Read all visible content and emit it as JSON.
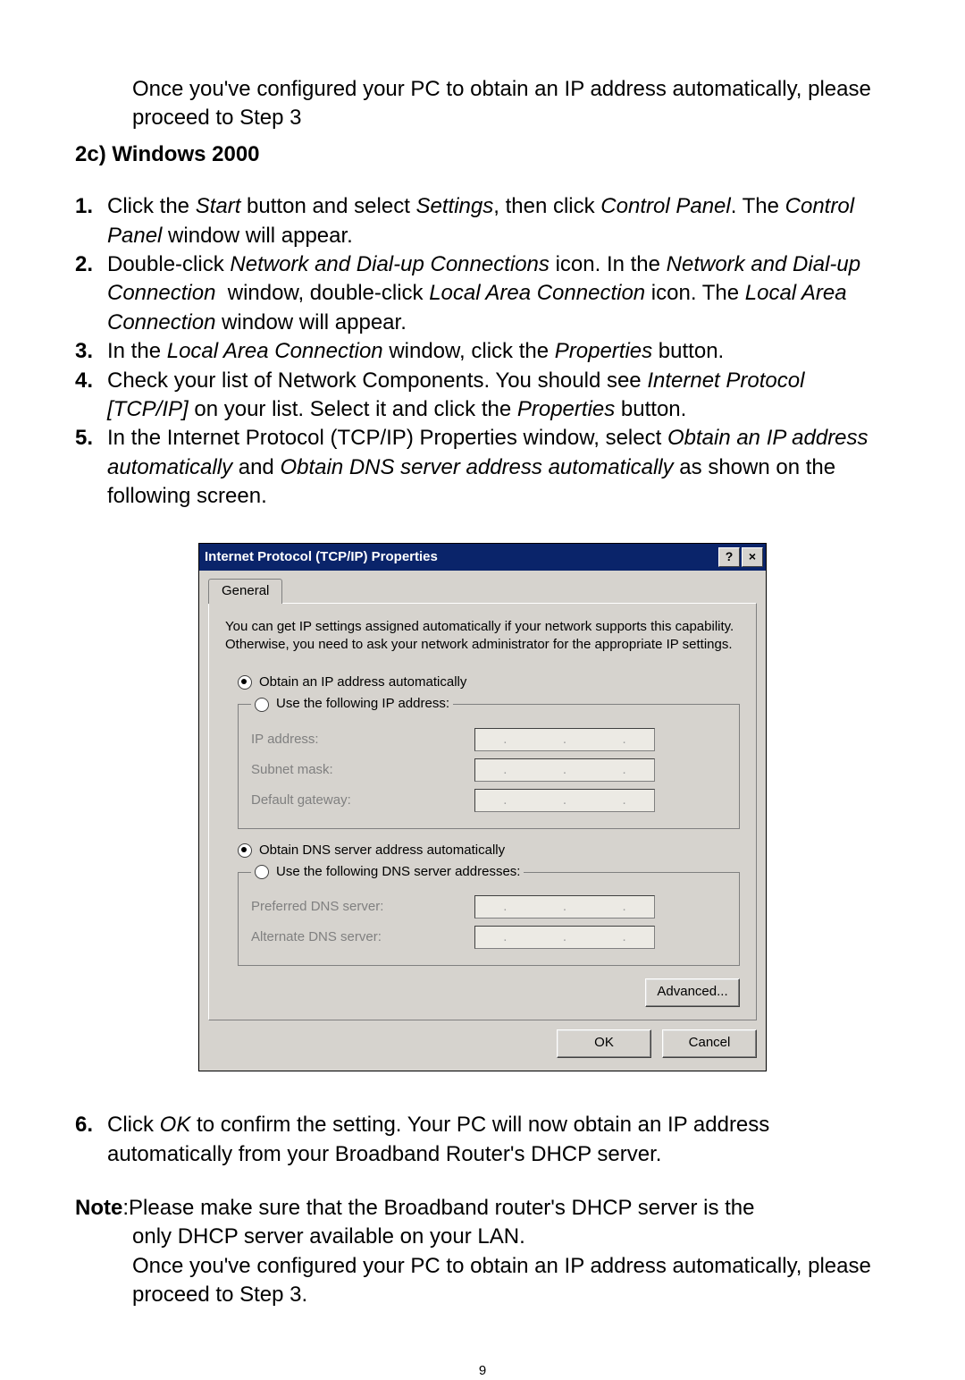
{
  "intro": "Once you've configured your PC to obtain an IP address automatically, please proceed to Step 3",
  "section_heading": "2c) Windows 2000",
  "steps": [
    {
      "n": "1.",
      "html": "Click the <em>Start</em> button and select <em>Settings</em>, then click <em>Control Panel</em>. The <em>Control Panel</em> window will appear."
    },
    {
      "n": "2.",
      "html": "Double-click <em>Network and Dial-up Connections</em> icon. In the <em>Network and Dial-up Connection</em>&nbsp; window, double-click <em>Local Area Connection</em> icon. The <em>Local Area Connection</em> window will appear."
    },
    {
      "n": "3.",
      "html": "In the <em>Local Area Connection</em> window, click the <em>Properties</em> button."
    },
    {
      "n": "4.",
      "html": "Check your list of Network Components. You should see <em>Internet Protocol [TCP/IP]</em> on your list. Select it and click the <em>Properties</em> button."
    },
    {
      "n": "5.",
      "html": "In the Internet Protocol (TCP/IP) Properties window, select <em>Obtain an IP address automatically</em> and <em>Obtain DNS server address automatically</em> as shown on the following screen."
    }
  ],
  "dialog": {
    "title": "Internet Protocol (TCP/IP) Properties",
    "help_btn": "?",
    "close_btn": "×",
    "tab": "General",
    "description": "You can get IP settings assigned automatically if your network supports this capability. Otherwise, you need to ask your network administrator for the appropriate IP settings.",
    "radio_obtain_ip": "Obtain an IP address automatically",
    "radio_use_ip": "Use the following IP address:",
    "lbl_ip": "IP address:",
    "lbl_subnet": "Subnet mask:",
    "lbl_gateway": "Default gateway:",
    "radio_obtain_dns": "Obtain DNS server address automatically",
    "radio_use_dns": "Use the following DNS server addresses:",
    "lbl_pref_dns": "Preferred DNS server:",
    "lbl_alt_dns": "Alternate DNS server:",
    "btn_advanced": "Advanced...",
    "btn_ok": "OK",
    "btn_cancel": "Cancel"
  },
  "step6": {
    "n": "6.",
    "html": "Click <em>OK</em> to confirm the setting. Your PC will now obtain an IP address automatically from your Broadband Router's DHCP server."
  },
  "note_label": "Note",
  "note_line1_rest": ":Please  make  sure  that  the  Broadband  router's  DHCP  server  is  the",
  "note_rest": "only DHCP server  available on your LAN.\nOnce you've configured your PC to obtain an IP address automatically, please proceed to Step 3.",
  "page_number": "9"
}
